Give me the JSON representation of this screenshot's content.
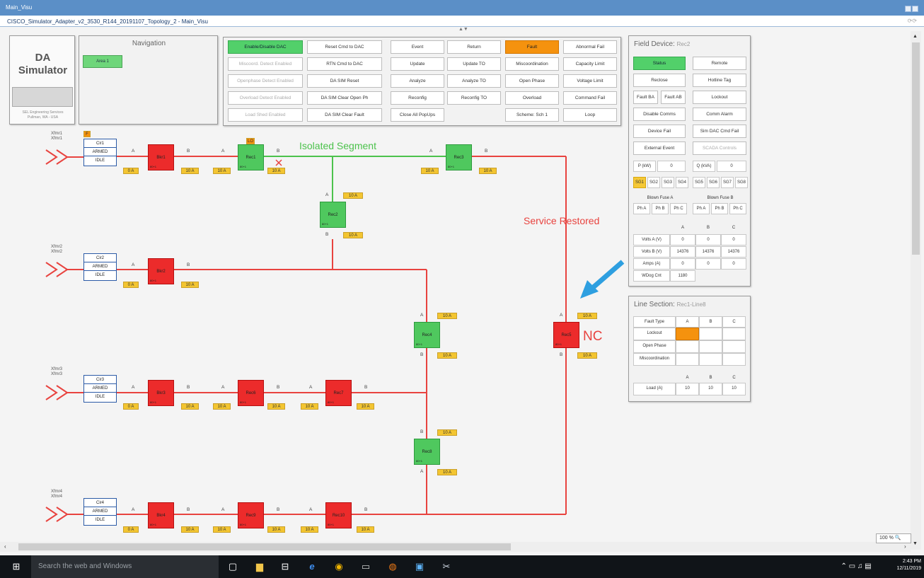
{
  "window": {
    "title": "Main_Visu",
    "subtitle": "CISCO_Simulator_Adapter_v2_3530_R144_20191107_Topology_2 - Main_Visu"
  },
  "da_panel": {
    "title_line1": "DA",
    "title_line2": "Simulator",
    "credit_line1": "SEL Engineering Services",
    "credit_line2": "Pullman, WA - USA"
  },
  "navigation": {
    "title": "Navigation",
    "area_button": "Area 1"
  },
  "commands": {
    "col1": [
      "Enable/Disable DAC",
      "Miscoord. Detect Enabled",
      "Openphase Detect Enabled",
      "Overload Detect Enabled",
      "Load Shed Enabled"
    ],
    "col2": [
      "Reset Cmd to DAC",
      "RTN Cmd to DAC",
      "DA SIM Reset",
      "DA SIM Clear Open Ph",
      "DA SIM Clear Fault"
    ],
    "col3": [
      "Event",
      "Update",
      "Analyze",
      "Reconfig",
      "Close All PopUps"
    ],
    "col4": [
      "Return",
      "Update TO",
      "Analyze TO",
      "Reconfig TO"
    ],
    "col5": [
      "Fault",
      "Miscoordination",
      "Open Phase",
      "Overload",
      "Scheme: Sch 1"
    ],
    "col6": [
      "Abnormal Fail",
      "Capacity Limit",
      "Voltage Limit",
      "Command Fail",
      "Loop"
    ]
  },
  "field_device": {
    "title": "Field Device:",
    "device": "Rec2",
    "buttons_left": [
      "Status",
      "Reclose",
      "Disable Comms",
      "Device Fail",
      "External Event"
    ],
    "buttons_right": [
      "Remote",
      "Hotline Tag",
      "Lockout",
      "Comm Alarm",
      "Sim DAC Cmd Fail",
      "SCADA Controls"
    ],
    "fault_ba": "Fault BA",
    "fault_ab": "Fault AB",
    "p_label": "P (kW)",
    "p_value": "0",
    "q_label": "Q (kVA)",
    "q_value": "0",
    "sg": [
      "SG1",
      "SG2",
      "SG3",
      "SG4",
      "SG5",
      "SG6",
      "SG7",
      "SG8"
    ],
    "blown_fuse_a": "Blown Fuse A",
    "blown_fuse_b": "Blown Fuse B",
    "phases": [
      "Ph A",
      "Ph B",
      "Ph C"
    ],
    "table_headers": [
      "A",
      "B",
      "C"
    ],
    "rows": [
      {
        "label": "Volts A (V)",
        "values": [
          "0",
          "0",
          "0"
        ]
      },
      {
        "label": "Volts B (V)",
        "values": [
          "14376",
          "14376",
          "14376"
        ]
      },
      {
        "label": "Amps (A)",
        "values": [
          "0",
          "0",
          "0"
        ]
      }
    ],
    "wdog_label": "WDog Cnt",
    "wdog_value": "1180"
  },
  "line_section": {
    "title": "Line Section:",
    "name": "Rec1-Line8",
    "fault_type_header": "Fault Type",
    "headers": [
      "A",
      "B",
      "C"
    ],
    "rows": [
      "Lockout",
      "Open Phase",
      "Miscoordination"
    ],
    "load_label": "Load (A)",
    "load_values": [
      "10",
      "10",
      "10"
    ]
  },
  "diagram": {
    "annotations": {
      "isolated": "Isolated Segment",
      "restored": "Service Restored",
      "nc": "NC"
    },
    "colors": {
      "energized": "#e8433f",
      "isolated": "#4cc24c",
      "arrow": "#2e9fe0"
    },
    "lo_badge": "LO",
    "f_badge": "F",
    "circuits": [
      {
        "xfmr": "Xfmr1\nXfmr1",
        "name": "Cir1",
        "armed": "ARMED",
        "state": "IDLE"
      },
      {
        "xfmr": "Xfmr2\nXfmr2",
        "name": "Cir2",
        "armed": "ARMED",
        "state": "IDLE"
      },
      {
        "xfmr": "Xfmr3\nXfmr3",
        "name": "Cir3",
        "armed": "ARMED",
        "state": "IDLE"
      },
      {
        "xfmr": "Xfmr4\nXfmr4",
        "name": "Cir4",
        "armed": "ARMED",
        "state": "IDLE"
      }
    ],
    "devices": {
      "Bkr1": "Bkr1",
      "Rec1": "Rec1",
      "Rec3": "Rec3",
      "Rec2": "Rec2",
      "Bkr2": "Bkr2",
      "Rec4": "Rec4",
      "Rec5": "Rec5",
      "Bkr3": "Bkr3",
      "Rec6": "Rec6",
      "Rec7": "Rec7",
      "Rec8": "Rec8",
      "Bkr4": "Bkr4",
      "Rec9": "Rec9",
      "Rec10": "Rec10"
    },
    "device_sub": "80+1",
    "tag_0": "0 A",
    "tag_10": "10 A",
    "port_a": "A",
    "port_b": "B"
  },
  "status_bar": {
    "zoom": "100 %"
  },
  "taskbar": {
    "search_placeholder": "Search the web and Windows",
    "time": "2:43 PM",
    "date": "12/11/2019"
  }
}
